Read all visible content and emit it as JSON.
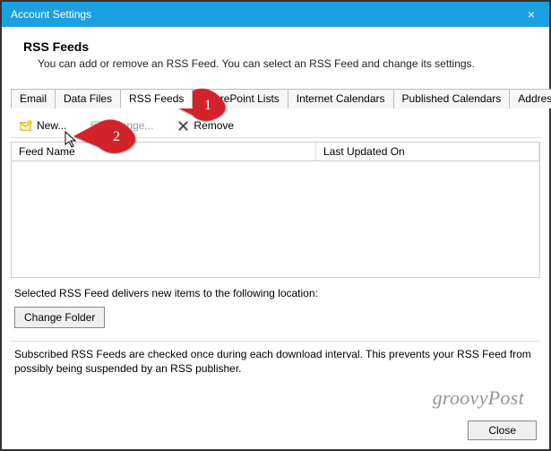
{
  "window": {
    "title": "Account Settings",
    "close_icon": "×"
  },
  "header": {
    "heading": "RSS Feeds",
    "subhead": "You can add or remove an RSS Feed. You can select an RSS Feed and change its settings."
  },
  "tabs": {
    "items": [
      {
        "label": "Email"
      },
      {
        "label": "Data Files"
      },
      {
        "label": "RSS Feeds",
        "active": true
      },
      {
        "label": "SharePoint Lists"
      },
      {
        "label": "Internet Calendars"
      },
      {
        "label": "Published Calendars"
      },
      {
        "label": "Address Books"
      }
    ]
  },
  "toolbar": {
    "new_label": "New...",
    "change_label": "Change...",
    "remove_label": "Remove"
  },
  "columns": {
    "feed": "Feed Name",
    "updated": "Last Updated On"
  },
  "location_text": "Selected RSS Feed delivers new items to the following location:",
  "change_folder_btn": "Change Folder",
  "note_text": "Subscribed RSS Feeds are checked once during each download interval. This prevents your RSS Feed from possibly being suspended by an RSS publisher.",
  "close_btn": "Close",
  "callouts": {
    "one": "1",
    "two": "2"
  },
  "watermark": "groovyPost"
}
